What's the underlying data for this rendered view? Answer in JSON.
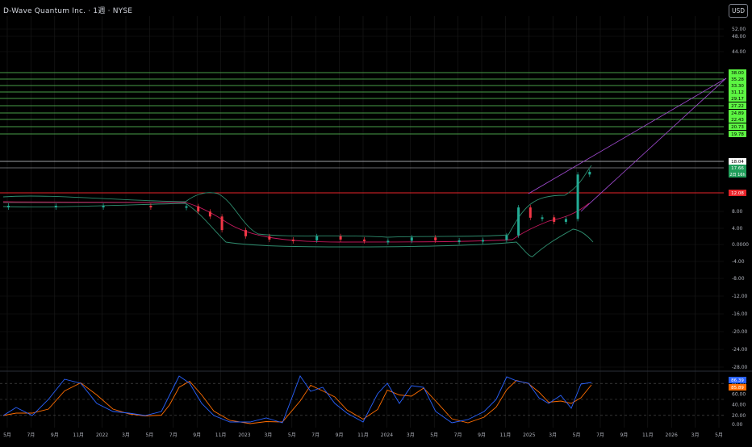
{
  "header": {
    "symbol_title": "D-Wave Quantum Inc. · 1週 · NYSE",
    "currency_button": "USD"
  },
  "colors": {
    "background": "#000000",
    "grid": "#1b1b1b",
    "axis_text": "#b2b5be",
    "level_line": "#5fd35f",
    "level_tag": "#5cf542",
    "red_line": "#e8242a",
    "up_candle": "#22ab94",
    "down_candle": "#f23645",
    "bollinger": "#2e8c6e",
    "basis": "#c2185b",
    "trendline": "#a64dd8",
    "stoch_k": "#2962ff",
    "stoch_d": "#ff6d00"
  },
  "chart_data": [
    {
      "type": "candlestick",
      "title": "D-Wave Quantum Inc. · 1週 · NYSE",
      "currency": "USD",
      "y_ticks": [
        "52.00",
        "48.00",
        "44.00",
        "8.00",
        "4.00",
        "0.0000",
        "-4.00",
        "-8.00",
        "-12.00",
        "-16.00",
        "-20.00",
        "-24.00",
        "-28.00"
      ],
      "ylim": [
        -28,
        52
      ],
      "x_ticks": [
        "5月",
        "7月",
        "9月",
        "11月",
        "2022",
        "3月",
        "5月",
        "7月",
        "9月",
        "11月",
        "2023",
        "3月",
        "5月",
        "7月",
        "9月",
        "11月",
        "2024",
        "3月",
        "5月",
        "7月",
        "9月",
        "11月",
        "2025",
        "3月",
        "5月",
        "7月",
        "9月",
        "11月",
        "2026",
        "3月",
        "5月"
      ],
      "horizontal_levels": [
        "38.00",
        "35.28",
        "33.30",
        "31.12",
        "29.17",
        "27.22",
        "24.89",
        "22.43",
        "20.73",
        "19.78"
      ],
      "white_level": "18.04",
      "price_tag": "17.66",
      "countdown_tag": "2日 16h",
      "red_level": "12.08",
      "price_series_approx": {
        "x": [
          "2021-05",
          "2021-09",
          "2022-01",
          "2022-05",
          "2022-08",
          "2022-09",
          "2022-10",
          "2022-11",
          "2023-01",
          "2023-03",
          "2023-05",
          "2023-07",
          "2023-09",
          "2023-11",
          "2024-01",
          "2024-03",
          "2024-05",
          "2024-07",
          "2024-09",
          "2024-11",
          "2024-12",
          "2025-01",
          "2025-02",
          "2025-03",
          "2025-04",
          "2025-05",
          "2025-06"
        ],
        "close": [
          9.4,
          9.4,
          9.4,
          9.3,
          9.3,
          8.0,
          6.8,
          3.5,
          2.0,
          1.2,
          1.0,
          2.0,
          1.2,
          0.9,
          0.9,
          1.7,
          1.0,
          1.0,
          1.1,
          2.2,
          9.0,
          6.5,
          6.6,
          5.5,
          6.2,
          17.0,
          17.66
        ]
      }
    },
    {
      "type": "line",
      "indicator": "Stochastic RSI",
      "y_ticks": [
        "0.00",
        "20.00",
        "40.00",
        "60.00",
        "80.00"
      ],
      "ylim": [
        0,
        100
      ],
      "k_value": "86.39",
      "d_value": "85.89"
    }
  ]
}
